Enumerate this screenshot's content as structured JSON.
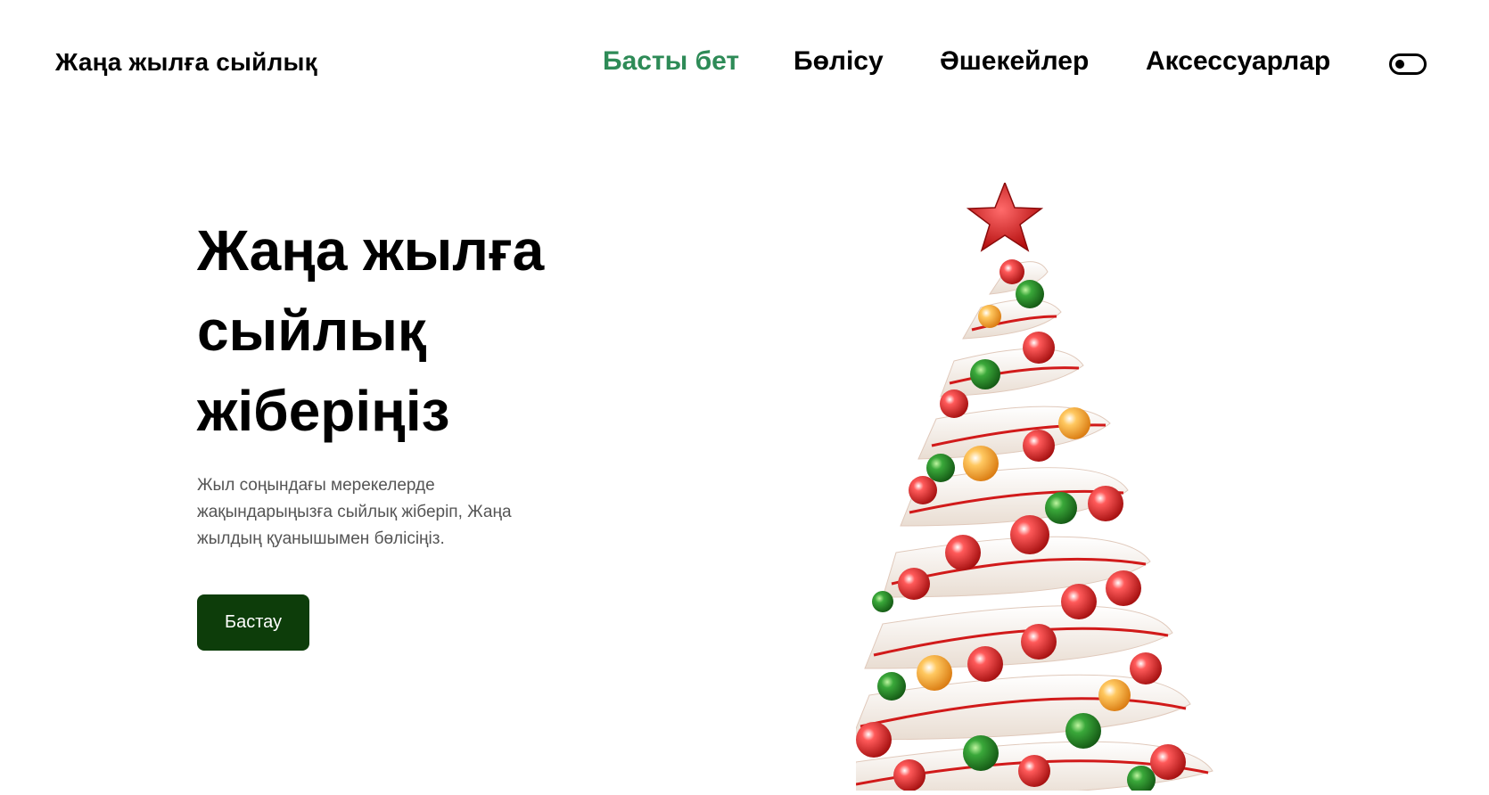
{
  "header": {
    "brand": "Жаңа жылға сыйлық",
    "nav": [
      {
        "label": "Басты бет",
        "active": true
      },
      {
        "label": "Бөлісу",
        "active": false
      },
      {
        "label": "Әшекейлер",
        "active": false
      },
      {
        "label": "Аксессуарлар",
        "active": false
      }
    ],
    "theme_toggle_icon": "toggle-icon"
  },
  "hero": {
    "title": "Жаңа жылға сыйлық жіберіңіз",
    "description": "Жыл соңындағы мерекелерде жақындарыңызға сыйлық жіберіп, Жаңа жылдың қуанышымен бөлісіңіз.",
    "cta_label": "Бастау",
    "image": "christmas-tree-illustration"
  },
  "colors": {
    "accent": "#2e8b57",
    "cta_bg": "#0d3d0a",
    "ornament_red": "#d11a1a",
    "ornament_green": "#1f7a1f",
    "ornament_orange": "#f0a020"
  }
}
